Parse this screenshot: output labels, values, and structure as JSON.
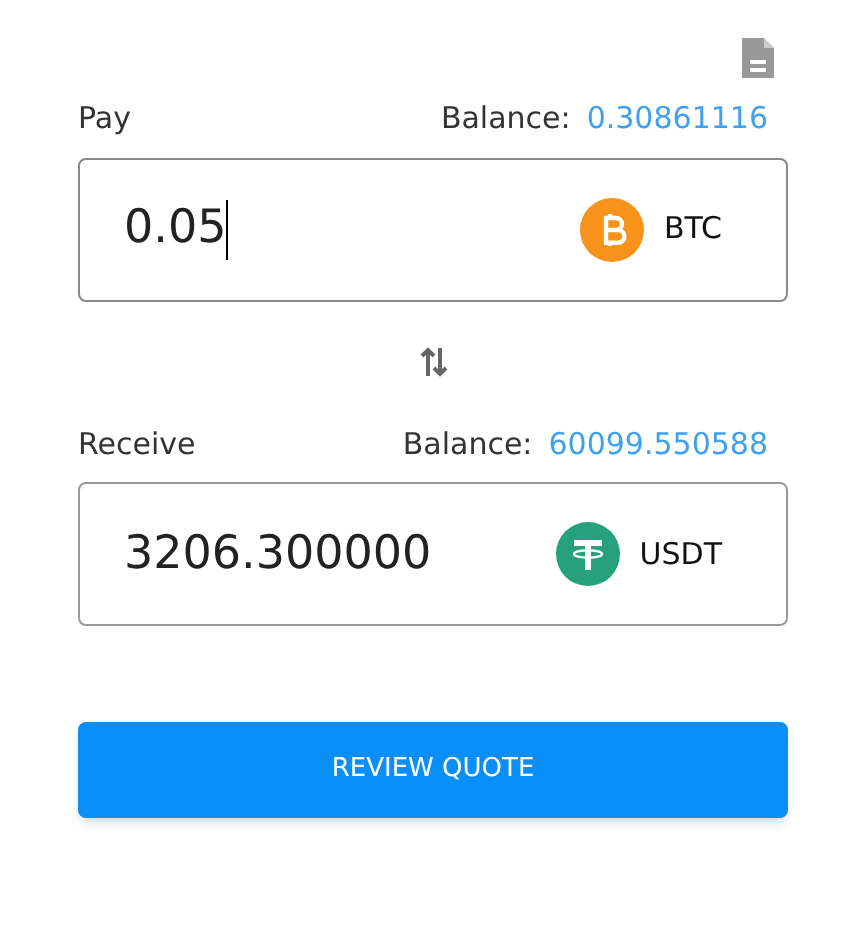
{
  "sections": [
    {
      "label": "Pay",
      "balance_label": "Balance:",
      "balance": "0.30861116",
      "value": "0.05",
      "focused": true,
      "currency": "BTC",
      "kind": "btc"
    },
    {
      "label": "Receive",
      "balance_label": "Balance:",
      "balance": "60099.550588",
      "value": "3206.300000",
      "focused": false,
      "currency": "USDT",
      "kind": "usdt"
    }
  ],
  "button": "REVIEW QUOTE"
}
